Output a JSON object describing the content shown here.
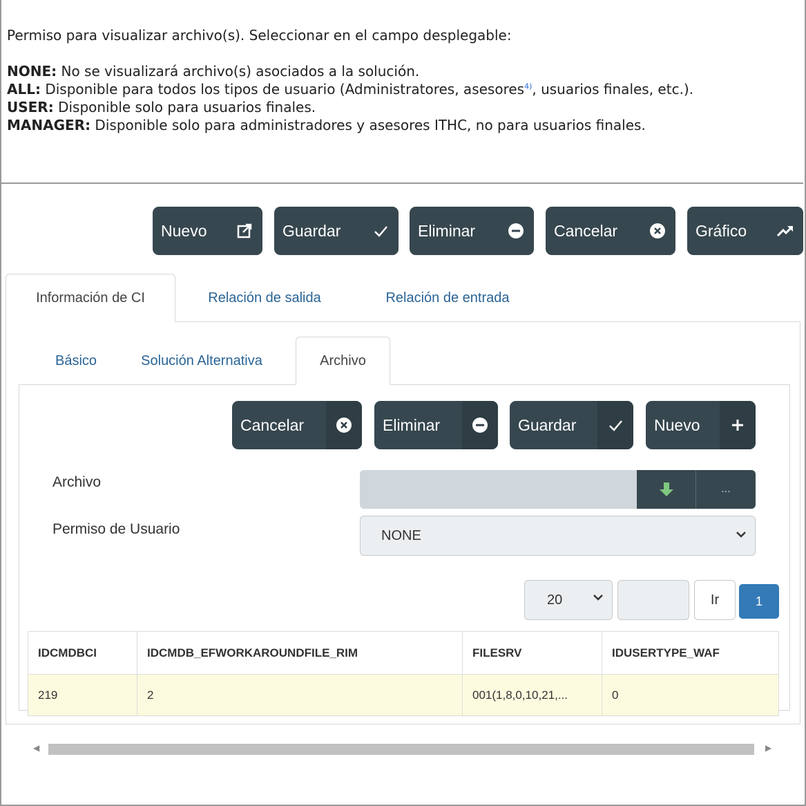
{
  "doc": {
    "intro": "Permiso para visualizar archivo(s). Seleccionar en el campo desplegable:",
    "items": [
      {
        "key": "NONE:",
        "text": " No se visualizará archivo(s) asociados a la solución."
      },
      {
        "key": "ALL:",
        "text_a": " Disponible para todos los tipos de usuario (Administratores, asesores",
        "footnote": "4)",
        "text_b": ", usuarios finales, etc.)."
      },
      {
        "key": "USER:",
        "text": " Disponible solo para usuarios finales."
      },
      {
        "key": "MANAGER:",
        "text": " Disponible solo para administradores y asesores ITHC, no para usuarios finales."
      }
    ]
  },
  "toolbar": {
    "buttons": [
      {
        "label": "Nuevo",
        "icon": "external-link-icon",
        "glyph": "⧉"
      },
      {
        "label": "Guardar",
        "icon": "check-icon",
        "glyph": "✓"
      },
      {
        "label": "Eliminar",
        "icon": "minus-circle-icon",
        "glyph": "⊖"
      },
      {
        "label": "Cancelar",
        "icon": "close-circle-icon",
        "glyph": "⊗"
      },
      {
        "label": "Gráfico",
        "icon": "trend-up-icon",
        "glyph": "↗"
      }
    ]
  },
  "main_tabs": [
    {
      "label": "Información de CI",
      "active": true
    },
    {
      "label": "Relación de salida",
      "active": false
    },
    {
      "label": "Relación de entrada",
      "active": false
    }
  ],
  "sub_tabs": [
    {
      "label": "Básico",
      "active": false
    },
    {
      "label": "Solución Alternativa",
      "active": false
    },
    {
      "label": "Archivo",
      "active": true
    }
  ],
  "file_toolbar": {
    "buttons": [
      {
        "label": "Cancelar",
        "icon": "close-circle-icon",
        "glyph": "⊗"
      },
      {
        "label": "Eliminar",
        "icon": "minus-circle-icon",
        "glyph": "⊖"
      },
      {
        "label": "Guardar",
        "icon": "check-icon",
        "glyph": "✓"
      },
      {
        "label": "Nuevo",
        "icon": "plus-icon",
        "glyph": "+"
      }
    ]
  },
  "form": {
    "file_label": "Archivo",
    "file_download_icon": "download-arrow-icon",
    "file_more_label": "...",
    "permission_label": "Permiso de Usuario",
    "permission_value": "NONE"
  },
  "pager": {
    "page_size": "20",
    "go_label": "Ir",
    "current_page": "1"
  },
  "grid": {
    "columns": [
      "IDCMDBCI",
      "IDCMDB_EFWORKAROUNDFILE_RIM",
      "FILESRV",
      "IDUSERTYPE_WAF"
    ],
    "rows": [
      [
        "219",
        "2",
        "001(1,8,0,10,21,...",
        "0"
      ]
    ]
  },
  "colors": {
    "button_bg": "#37474f",
    "link_blue": "#2a6496",
    "row_highlight": "#fcfbdf",
    "page_active": "#337ab7"
  }
}
